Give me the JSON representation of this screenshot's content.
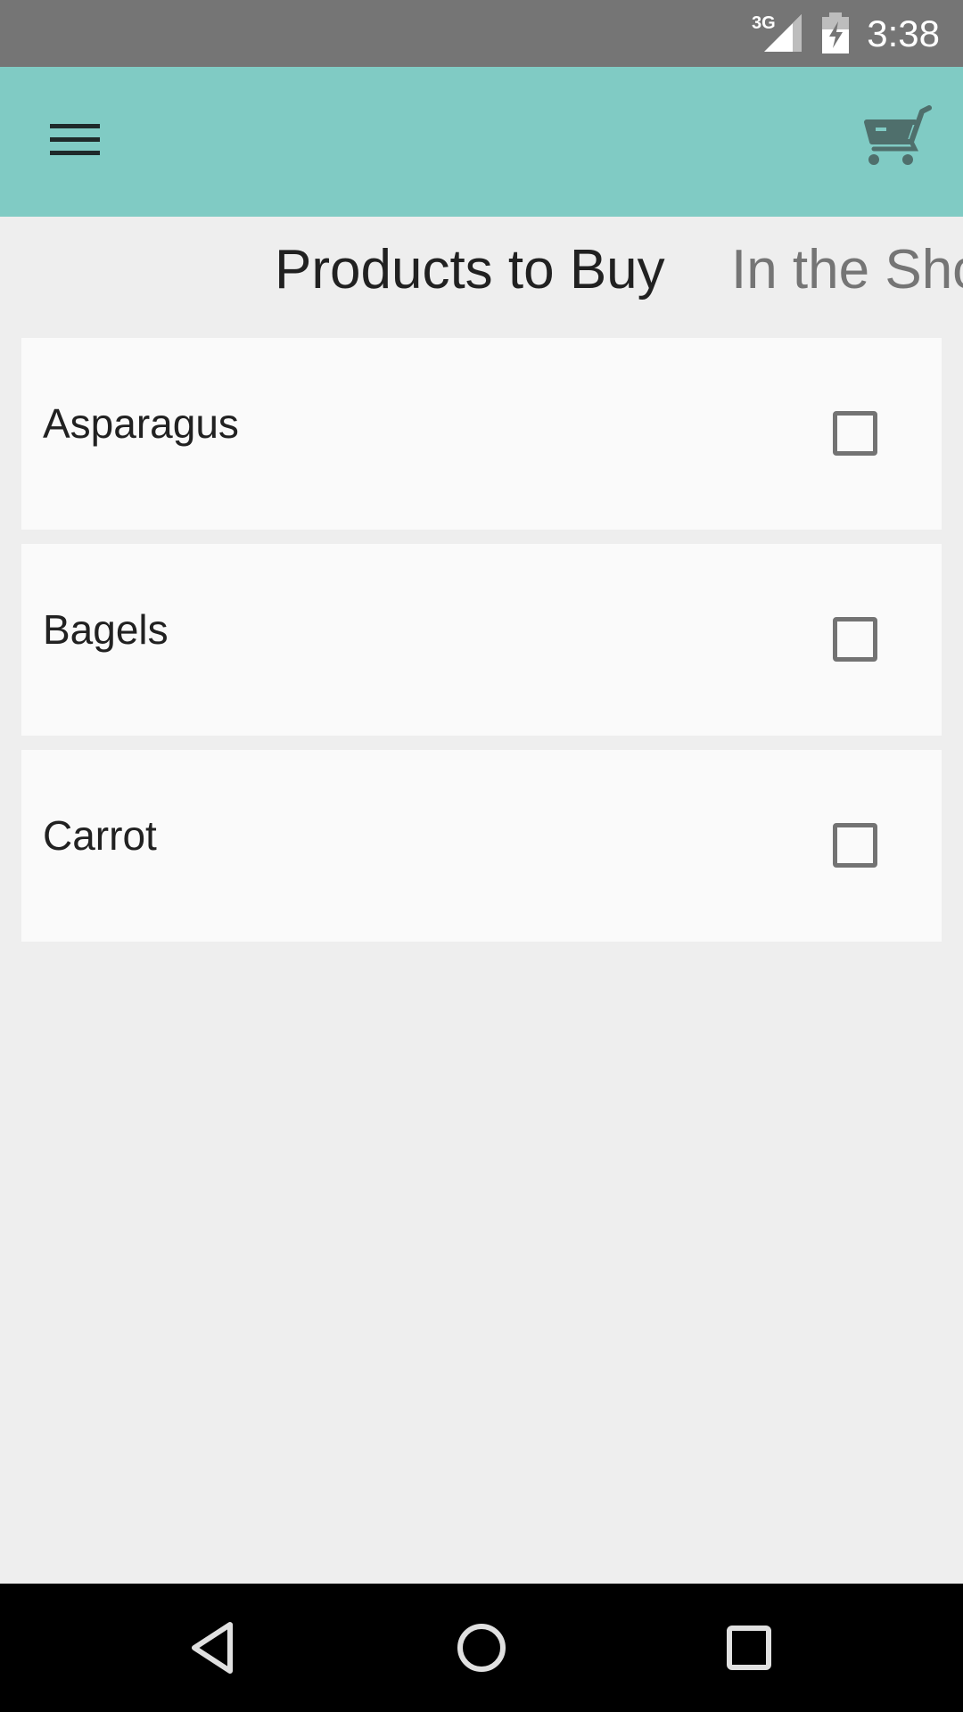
{
  "status_bar": {
    "network_type": "3G",
    "time": "3:38",
    "icons": [
      "signal-icon",
      "battery-charging-icon"
    ],
    "color": "#757575"
  },
  "app_bar": {
    "color": "#80cbc4",
    "icons": [
      "hamburger-menu-icon",
      "shopping-cart-icon"
    ]
  },
  "tabs": [
    {
      "label": "Products to Buy",
      "selected": true
    },
    {
      "label": "In the Shopping Cart",
      "selected": false
    }
  ],
  "products": [
    {
      "name": "Asparagus",
      "checked": false
    },
    {
      "name": "Bagels",
      "checked": false
    },
    {
      "name": "Carrot",
      "checked": false
    }
  ],
  "nav_bar": {
    "icons": [
      "back-icon",
      "home-icon",
      "recents-icon"
    ]
  }
}
